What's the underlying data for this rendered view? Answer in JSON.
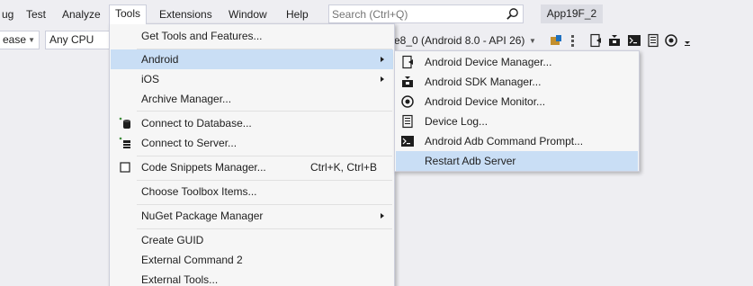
{
  "menubar": {
    "items": [
      "ug",
      "Test",
      "Analyze",
      "Tools",
      "Extensions",
      "Window",
      "Help"
    ],
    "active": "Tools",
    "search_placeholder": "Search (Ctrl+Q)",
    "app_title": "App19F_2"
  },
  "toolbar": {
    "config_value": "ease",
    "platform_value": "Any CPU",
    "device_value": "e8_0 (Android 8.0 - API 26)"
  },
  "tools_menu": {
    "items": [
      {
        "label": "Get Tools and Features..."
      },
      {
        "label": "Android",
        "submenu": true
      },
      {
        "label": "iOS",
        "submenu": true
      },
      {
        "label": "Archive Manager..."
      },
      {
        "label": "Connect to Database...",
        "icon": "database-icon"
      },
      {
        "label": "Connect to Server...",
        "icon": "server-icon"
      },
      {
        "label": "Code Snippets Manager...",
        "shortcut": "Ctrl+K, Ctrl+B",
        "icon": "snippet-icon"
      },
      {
        "label": "Choose Toolbox Items..."
      },
      {
        "label": "NuGet Package Manager",
        "submenu": true
      },
      {
        "label": "Create GUID"
      },
      {
        "label": "External Command 2"
      },
      {
        "label": "External Tools..."
      }
    ]
  },
  "android_menu": {
    "items": [
      {
        "label": "Android Device Manager...",
        "icon": "device-manager-icon"
      },
      {
        "label": "Android SDK Manager...",
        "icon": "sdk-manager-icon"
      },
      {
        "label": "Android Device Monitor...",
        "icon": "device-monitor-icon"
      },
      {
        "label": "Device Log...",
        "icon": "device-log-icon"
      },
      {
        "label": "Android Adb Command Prompt...",
        "icon": "command-prompt-icon"
      },
      {
        "label": "Restart Adb Server"
      }
    ]
  },
  "colors": {
    "highlight": "#c9def5",
    "menu_bg": "#f6f6f6",
    "chrome_bg": "#eeeef2"
  }
}
